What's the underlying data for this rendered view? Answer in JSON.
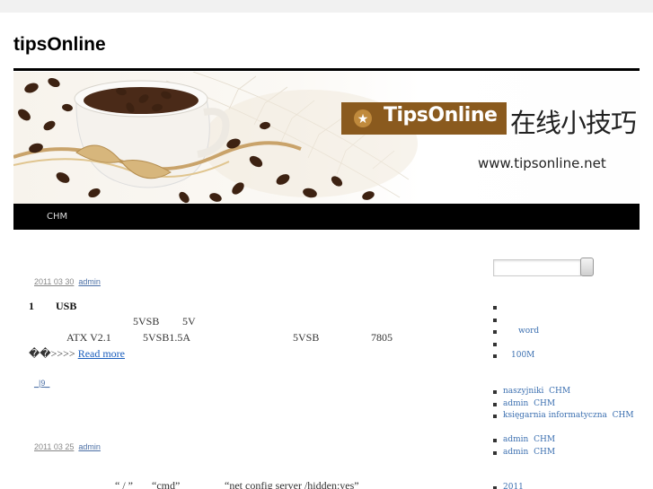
{
  "site": {
    "title": "tipsOnline"
  },
  "banner": {
    "brand": "TipsOnline",
    "tagline": "在线小技巧",
    "url": "www.tipsonline.net"
  },
  "nav": {
    "items": [
      "CHM"
    ]
  },
  "posts": [
    {
      "date": "2011 03 30",
      "author": "admin",
      "lines": [
        "1",
        "USB",
        "5VSB",
        "5V",
        "ATX V2.1",
        "5VSB1.5A",
        "5VSB",
        "7805"
      ],
      "more_prefix": "��>>>>",
      "more_label": "Read more",
      "tags": "_|9_"
    },
    {
      "date": "2011 03 25",
      "author": "admin",
      "lines": [
        "“ / ”",
        "“cmd”",
        "“net config server /hidden:yes”"
      ]
    }
  ],
  "sidebar": {
    "search": {
      "placeholder": ""
    },
    "list1": [
      "",
      "",
      "word",
      "",
      "100M"
    ],
    "list2": [
      {
        "a": "naszyjniki",
        "b": "CHM"
      },
      {
        "a": "admin",
        "b": "CHM"
      },
      {
        "a": "księgarnia informatyczna",
        "b": "CHM"
      }
    ],
    "list3": [
      {
        "a": "admin",
        "b": "CHM"
      },
      {
        "a": "admin",
        "b": "CHM"
      }
    ],
    "list4": [
      "2011"
    ]
  }
}
